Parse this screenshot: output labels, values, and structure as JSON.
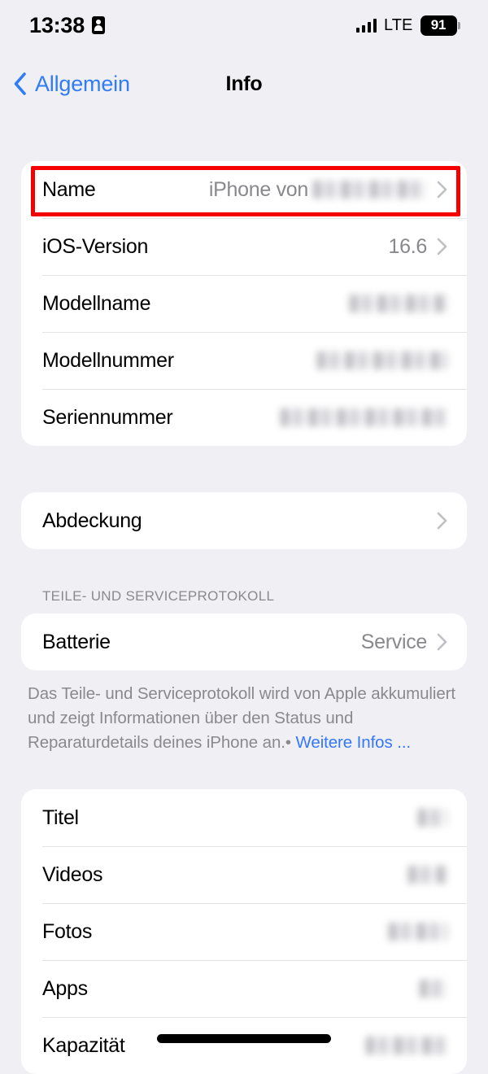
{
  "status_bar": {
    "time": "13:38",
    "orientation_icon": "portrait-lock-icon",
    "signal_icon": "cellular-signal-icon",
    "carrier_network": "LTE",
    "battery_percent": "91"
  },
  "nav": {
    "back_label": "Allgemein",
    "back_icon": "chevron-left-icon",
    "title": "Info"
  },
  "sections": [
    {
      "id": "device-info",
      "rows": [
        {
          "label": "Name",
          "value": "iPhone von",
          "redacted": true,
          "redacted_width": 140,
          "chevron": true,
          "highlighted": true
        },
        {
          "label": "iOS-Version",
          "value": "16.6",
          "redacted": false,
          "chevron": true
        },
        {
          "label": "Modellname",
          "value": "",
          "redacted": true,
          "redacted_width": 120,
          "chevron": false
        },
        {
          "label": "Modellnummer",
          "value": "",
          "redacted": true,
          "redacted_width": 160,
          "chevron": false
        },
        {
          "label": "Seriennummer",
          "value": "",
          "redacted": true,
          "redacted_width": 205,
          "chevron": false
        }
      ]
    },
    {
      "id": "coverage",
      "rows": [
        {
          "label": "Abdeckung",
          "value": "",
          "redacted": false,
          "chevron": true
        }
      ]
    },
    {
      "id": "parts-service",
      "header": "TEILE- UND SERVICEPROTOKOLL",
      "rows": [
        {
          "label": "Batterie",
          "value": "Service",
          "redacted": false,
          "chevron": true
        }
      ],
      "footer": {
        "text": "Das Teile- und Serviceprotokoll wird von Apple akkumuliert und zeigt Informationen über den Status und Reparaturdetails deines iPhone an.",
        "separator": "•",
        "link_label": "Weitere Infos ..."
      }
    },
    {
      "id": "storage",
      "rows": [
        {
          "label": "Titel",
          "value": "",
          "redacted": true,
          "redacted_width": 36,
          "chevron": false
        },
        {
          "label": "Videos",
          "value": "",
          "redacted": true,
          "redacted_width": 48,
          "chevron": false
        },
        {
          "label": "Fotos",
          "value": "",
          "redacted": true,
          "redacted_width": 72,
          "chevron": false
        },
        {
          "label": "Apps",
          "value": "",
          "redacted": true,
          "redacted_width": 34,
          "chevron": false
        },
        {
          "label": "Kapazität",
          "value": "",
          "redacted": true,
          "redacted_width": 100,
          "chevron": false
        }
      ]
    }
  ],
  "colors": {
    "background": "#F0EFF4",
    "card": "#FFFFFF",
    "accent_blue": "#2F7CF6",
    "link_blue": "#3478F6",
    "secondary_text": "#88888D",
    "highlight_red": "#F40000"
  },
  "annotation": {
    "type": "red-rectangle-highlight",
    "target_row": "Name"
  },
  "home_indicator": "home-indicator-bar"
}
